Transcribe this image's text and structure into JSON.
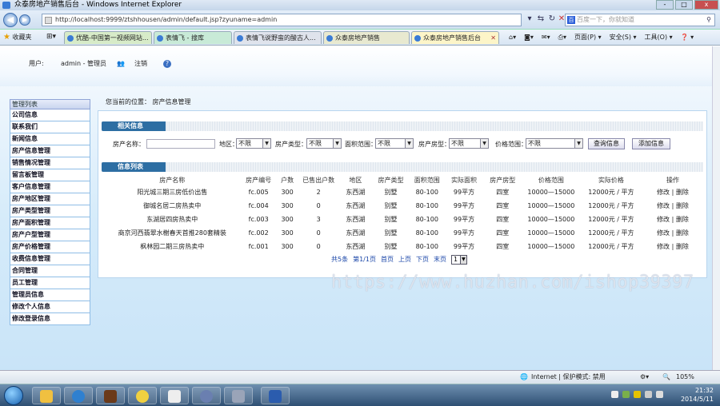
{
  "window": {
    "title": "众泰房地产销售后台 - Windows Internet Explorer",
    "buttons": [
      "-",
      "□",
      "x"
    ]
  },
  "address_bar": {
    "url": "http://localhost:9999/ztshhousen/admin/default.jsp?zyuname=admin",
    "search_placeholder": "百度一下，你就知道"
  },
  "favorites": {
    "label": "收藏夹",
    "tabs": [
      {
        "label": "优酷-中国第一视频网站..."
      },
      {
        "label": "表情飞 - 搜库"
      },
      {
        "label": "表情飞说野蛮的酸古人..."
      },
      {
        "label": "众泰房地产销售"
      },
      {
        "label": "众泰房地产销售后台",
        "active": true
      }
    ],
    "tools": [
      "页面(P) ▾",
      "安全(S) ▾",
      "工具(O) ▾",
      "❓ ▾"
    ]
  },
  "banner": {
    "user_label": "用户:",
    "user_value": "admin - 管理员",
    "logout": "注销"
  },
  "sidebar": {
    "header": "管理列表",
    "items": [
      "公司信息",
      "联系我们",
      "新闻信息",
      "房产信息管理",
      "销售情况管理",
      "留言板管理",
      "客户信息管理",
      "房产地区管理",
      "房产类型管理",
      "房产面积管理",
      "房产户型管理",
      "房产价格管理",
      "收费信息管理",
      "合同管理",
      "员工管理",
      "管理员信息",
      "修改个人信息",
      "修改登录信息"
    ]
  },
  "content": {
    "breadcrumb": "您当前的位置：  房产信息管理",
    "section1_title": "相关信息",
    "section2_title": "信息列表",
    "search": {
      "name_label": "房产名称：",
      "area_label": "地区：",
      "area_value": "不限",
      "type_label": "房产类型：",
      "type_value": "不限",
      "size_label": "面积范围：",
      "size_value": "不限",
      "house_label": "房产房型：",
      "house_value": "不限",
      "price_label": "价格范围：",
      "price_value": "不限",
      "query_button": "查询信息",
      "add_button": "添加信息"
    },
    "table": {
      "headers": [
        "房产名称",
        "房产编号",
        "户数",
        "已售出户数",
        "地区",
        "房产类型",
        "面积范围",
        "实际面积",
        "房产房型",
        "价格范围",
        "实际价格",
        "操作"
      ],
      "rows": [
        {
          "name": "阳光城三期三房低价出售",
          "code": "fc.005",
          "units": "300",
          "sold": "2",
          "area": "东西湖",
          "type": "别墅",
          "size": "80-100",
          "actual_size": "99平方",
          "layout": "四室",
          "price": "10000—15000",
          "actual_price": "12000元 / 平方",
          "edit": "修改",
          "delete": "删除"
        },
        {
          "name": "御城名居二房热卖中",
          "code": "fc.004",
          "units": "300",
          "sold": "0",
          "area": "东西湖",
          "type": "别墅",
          "size": "80-100",
          "actual_size": "99平方",
          "layout": "四室",
          "price": "10000—15000",
          "actual_price": "12000元 / 平方",
          "edit": "修改",
          "delete": "删除"
        },
        {
          "name": "东湖居四房热卖中",
          "code": "fc.003",
          "units": "300",
          "sold": "3",
          "area": "东西湖",
          "type": "别墅",
          "size": "80-100",
          "actual_size": "99平方",
          "layout": "四室",
          "price": "10000—15000",
          "actual_price": "12000元 / 平方",
          "edit": "修改",
          "delete": "删除"
        },
        {
          "name": "商京河西翡翠水榭春天首推280套精装",
          "code": "fc.002",
          "units": "300",
          "sold": "0",
          "area": "东西湖",
          "type": "别墅",
          "size": "80-100",
          "actual_size": "99平方",
          "layout": "四室",
          "price": "10000—15000",
          "actual_price": "12000元 / 平方",
          "edit": "修改",
          "delete": "删除"
        },
        {
          "name": "枫林园二期三房热卖中",
          "code": "fc.001",
          "units": "300",
          "sold": "0",
          "area": "东西湖",
          "type": "别墅",
          "size": "80-100",
          "actual_size": "99平方",
          "layout": "四室",
          "price": "10000—15000",
          "actual_price": "12000元 / 平方",
          "edit": "修改",
          "delete": "删除"
        }
      ]
    },
    "pager": {
      "total": "共5条",
      "page": "第1/1页",
      "first": "首页",
      "prev": "上页",
      "next": "下页",
      "last": "末页",
      "select": "1"
    }
  },
  "watermark": "https://www.huzhan.com/ishop39397",
  "statusbar": {
    "zone": "Internet | 保护模式: 禁用",
    "zoom": "105%"
  },
  "taskbar": {
    "time": "21:32",
    "date": "2014/5/11"
  },
  "colors": {
    "section_head": "#2d6ea3",
    "sidebar_border": "#8fbde6",
    "link": "#1a46a8"
  }
}
